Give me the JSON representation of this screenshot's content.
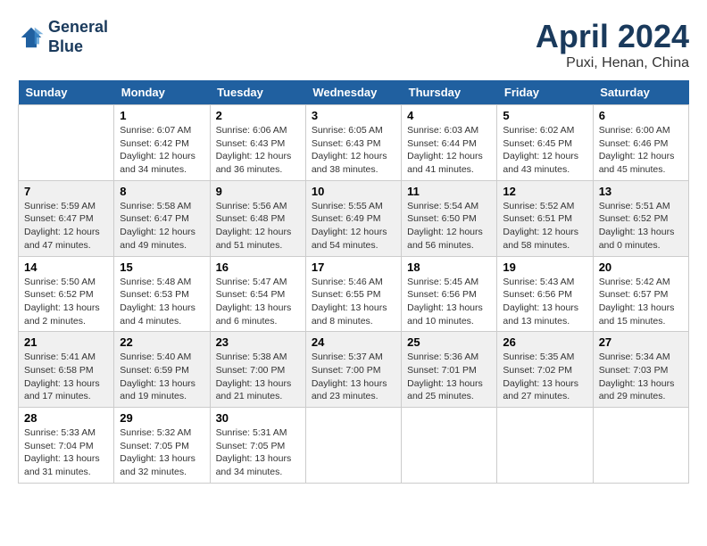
{
  "header": {
    "logo_line1": "General",
    "logo_line2": "Blue",
    "month": "April 2024",
    "location": "Puxi, Henan, China"
  },
  "weekdays": [
    "Sunday",
    "Monday",
    "Tuesday",
    "Wednesday",
    "Thursday",
    "Friday",
    "Saturday"
  ],
  "weeks": [
    [
      {
        "day": "",
        "content": ""
      },
      {
        "day": "1",
        "content": "Sunrise: 6:07 AM\nSunset: 6:42 PM\nDaylight: 12 hours\nand 34 minutes."
      },
      {
        "day": "2",
        "content": "Sunrise: 6:06 AM\nSunset: 6:43 PM\nDaylight: 12 hours\nand 36 minutes."
      },
      {
        "day": "3",
        "content": "Sunrise: 6:05 AM\nSunset: 6:43 PM\nDaylight: 12 hours\nand 38 minutes."
      },
      {
        "day": "4",
        "content": "Sunrise: 6:03 AM\nSunset: 6:44 PM\nDaylight: 12 hours\nand 41 minutes."
      },
      {
        "day": "5",
        "content": "Sunrise: 6:02 AM\nSunset: 6:45 PM\nDaylight: 12 hours\nand 43 minutes."
      },
      {
        "day": "6",
        "content": "Sunrise: 6:00 AM\nSunset: 6:46 PM\nDaylight: 12 hours\nand 45 minutes."
      }
    ],
    [
      {
        "day": "7",
        "content": "Sunrise: 5:59 AM\nSunset: 6:47 PM\nDaylight: 12 hours\nand 47 minutes."
      },
      {
        "day": "8",
        "content": "Sunrise: 5:58 AM\nSunset: 6:47 PM\nDaylight: 12 hours\nand 49 minutes."
      },
      {
        "day": "9",
        "content": "Sunrise: 5:56 AM\nSunset: 6:48 PM\nDaylight: 12 hours\nand 51 minutes."
      },
      {
        "day": "10",
        "content": "Sunrise: 5:55 AM\nSunset: 6:49 PM\nDaylight: 12 hours\nand 54 minutes."
      },
      {
        "day": "11",
        "content": "Sunrise: 5:54 AM\nSunset: 6:50 PM\nDaylight: 12 hours\nand 56 minutes."
      },
      {
        "day": "12",
        "content": "Sunrise: 5:52 AM\nSunset: 6:51 PM\nDaylight: 12 hours\nand 58 minutes."
      },
      {
        "day": "13",
        "content": "Sunrise: 5:51 AM\nSunset: 6:52 PM\nDaylight: 13 hours\nand 0 minutes."
      }
    ],
    [
      {
        "day": "14",
        "content": "Sunrise: 5:50 AM\nSunset: 6:52 PM\nDaylight: 13 hours\nand 2 minutes."
      },
      {
        "day": "15",
        "content": "Sunrise: 5:48 AM\nSunset: 6:53 PM\nDaylight: 13 hours\nand 4 minutes."
      },
      {
        "day": "16",
        "content": "Sunrise: 5:47 AM\nSunset: 6:54 PM\nDaylight: 13 hours\nand 6 minutes."
      },
      {
        "day": "17",
        "content": "Sunrise: 5:46 AM\nSunset: 6:55 PM\nDaylight: 13 hours\nand 8 minutes."
      },
      {
        "day": "18",
        "content": "Sunrise: 5:45 AM\nSunset: 6:56 PM\nDaylight: 13 hours\nand 10 minutes."
      },
      {
        "day": "19",
        "content": "Sunrise: 5:43 AM\nSunset: 6:56 PM\nDaylight: 13 hours\nand 13 minutes."
      },
      {
        "day": "20",
        "content": "Sunrise: 5:42 AM\nSunset: 6:57 PM\nDaylight: 13 hours\nand 15 minutes."
      }
    ],
    [
      {
        "day": "21",
        "content": "Sunrise: 5:41 AM\nSunset: 6:58 PM\nDaylight: 13 hours\nand 17 minutes."
      },
      {
        "day": "22",
        "content": "Sunrise: 5:40 AM\nSunset: 6:59 PM\nDaylight: 13 hours\nand 19 minutes."
      },
      {
        "day": "23",
        "content": "Sunrise: 5:38 AM\nSunset: 7:00 PM\nDaylight: 13 hours\nand 21 minutes."
      },
      {
        "day": "24",
        "content": "Sunrise: 5:37 AM\nSunset: 7:00 PM\nDaylight: 13 hours\nand 23 minutes."
      },
      {
        "day": "25",
        "content": "Sunrise: 5:36 AM\nSunset: 7:01 PM\nDaylight: 13 hours\nand 25 minutes."
      },
      {
        "day": "26",
        "content": "Sunrise: 5:35 AM\nSunset: 7:02 PM\nDaylight: 13 hours\nand 27 minutes."
      },
      {
        "day": "27",
        "content": "Sunrise: 5:34 AM\nSunset: 7:03 PM\nDaylight: 13 hours\nand 29 minutes."
      }
    ],
    [
      {
        "day": "28",
        "content": "Sunrise: 5:33 AM\nSunset: 7:04 PM\nDaylight: 13 hours\nand 31 minutes."
      },
      {
        "day": "29",
        "content": "Sunrise: 5:32 AM\nSunset: 7:05 PM\nDaylight: 13 hours\nand 32 minutes."
      },
      {
        "day": "30",
        "content": "Sunrise: 5:31 AM\nSunset: 7:05 PM\nDaylight: 13 hours\nand 34 minutes."
      },
      {
        "day": "",
        "content": ""
      },
      {
        "day": "",
        "content": ""
      },
      {
        "day": "",
        "content": ""
      },
      {
        "day": "",
        "content": ""
      }
    ]
  ]
}
